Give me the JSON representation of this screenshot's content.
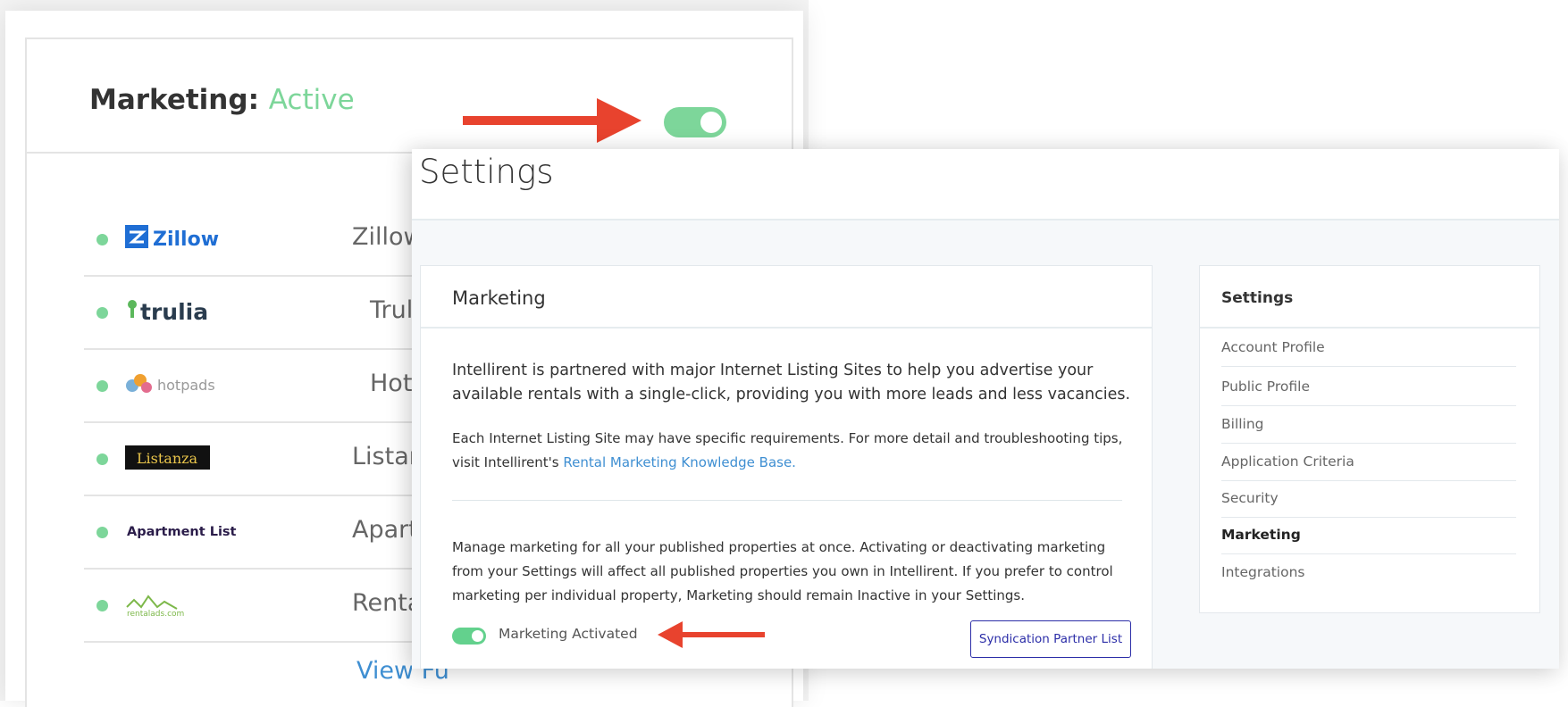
{
  "status_card": {
    "title_prefix": "Marketing:",
    "status": "Active",
    "toggle_on": true,
    "partners": [
      {
        "logo_text": "Zillow",
        "name": "Zillow"
      },
      {
        "logo_text": "trulia",
        "name": "Trulia"
      },
      {
        "logo_text": "hotpads",
        "name": "Hotpa"
      },
      {
        "logo_text": "Listanza",
        "name": "Listanza"
      },
      {
        "logo_text": "Apartment List",
        "name": "Apartme"
      },
      {
        "logo_text": "rentalads.com",
        "name": "Rental A"
      }
    ],
    "view_full_link": "View Fu"
  },
  "settings": {
    "page_title": "Settings",
    "marketing_card": {
      "title": "Marketing",
      "intro": "Intellirent is partnered with major Internet Listing Sites to help you advertise your available rentals with a single-click, providing you with more leads and less vacancies.",
      "requirements_text": "Each Internet Listing Site may have specific requirements. For more detail and troubleshooting tips, visit Intellirent's",
      "knowledge_base_link": "Rental Marketing Knowledge Base.",
      "manage_text": "Manage marketing for all your published properties at once. Activating or deactivating marketing from your Settings will affect all published properties you own in Intellirent. If you prefer to control marketing per individual property, Marketing should remain Inactive in your Settings.",
      "toggle_label": "Marketing Activated",
      "toggle_on": true,
      "syndication_button": "Syndication Partner List"
    },
    "sidebar": {
      "title": "Settings",
      "items": [
        {
          "label": "Account Profile"
        },
        {
          "label": "Public Profile"
        },
        {
          "label": "Billing"
        },
        {
          "label": "Application Criteria"
        },
        {
          "label": "Security"
        },
        {
          "label": "Marketing",
          "active": true
        },
        {
          "label": "Integrations"
        }
      ]
    }
  },
  "colors": {
    "active_green": "#7dd69a",
    "arrow_red": "#e8432e",
    "link_blue": "#3f8fd2",
    "button_navy": "#2c2ea8"
  }
}
